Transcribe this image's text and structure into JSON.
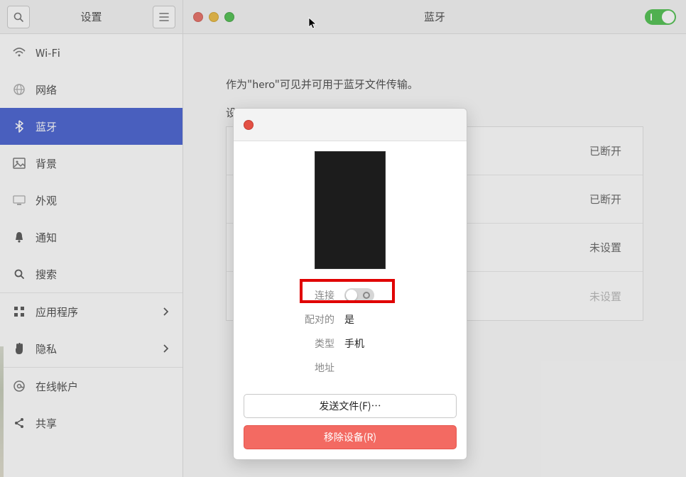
{
  "sidebar": {
    "title": "设置",
    "items": [
      {
        "label": "Wi-Fi"
      },
      {
        "label": "网络"
      },
      {
        "label": "蓝牙"
      },
      {
        "label": "背景"
      },
      {
        "label": "外观"
      },
      {
        "label": "通知"
      },
      {
        "label": "搜索"
      },
      {
        "label": "应用程序"
      },
      {
        "label": "隐私"
      },
      {
        "label": "在线帐户"
      },
      {
        "label": "共享"
      }
    ]
  },
  "header": {
    "title": "蓝牙"
  },
  "main": {
    "visibility_text": "作为\"hero\"可见并可用于蓝牙文件传输。",
    "devices_label": "设",
    "device_rows": [
      {
        "status": "已断开"
      },
      {
        "status": "已断开"
      },
      {
        "status": "未设置"
      },
      {
        "status": "未设置"
      }
    ]
  },
  "modal": {
    "props": {
      "connect_label": "连接",
      "paired_label": "配对的",
      "paired_value": "是",
      "type_label": "类型",
      "type_value": "手机",
      "address_label": "地址",
      "address_value": ""
    },
    "send_file_label": "发送文件(F)…",
    "remove_label": "移除设备(R)"
  }
}
